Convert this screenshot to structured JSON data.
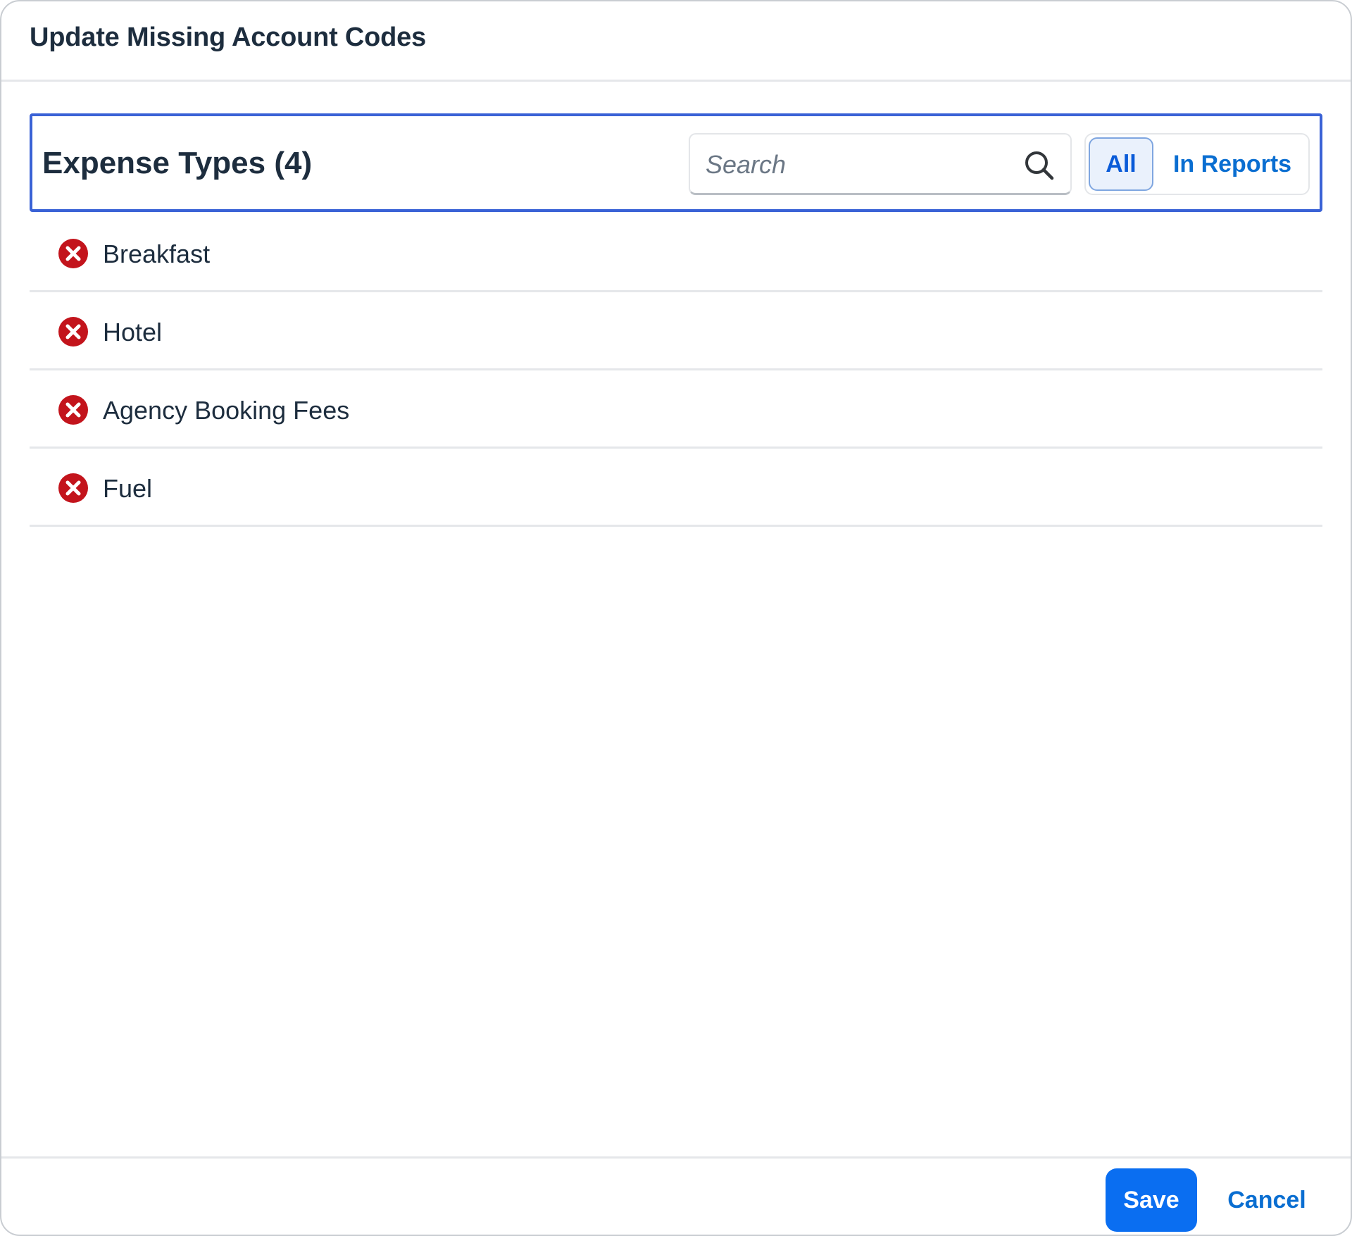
{
  "dialog": {
    "title": "Update Missing Account Codes"
  },
  "toolbar": {
    "title": "Expense Types (4)",
    "search": {
      "placeholder": "Search",
      "value": "",
      "icon": "search-icon"
    },
    "segments": [
      {
        "label": "All",
        "selected": true
      },
      {
        "label": "In Reports",
        "selected": false
      }
    ]
  },
  "items": [
    {
      "label": "Breakfast",
      "status_icon": "error-icon"
    },
    {
      "label": "Hotel",
      "status_icon": "error-icon"
    },
    {
      "label": "Agency Booking Fees",
      "status_icon": "error-icon"
    },
    {
      "label": "Fuel",
      "status_icon": "error-icon"
    }
  ],
  "footer": {
    "save_label": "Save",
    "cancel_label": "Cancel"
  },
  "colors": {
    "accent": "#0a6ef1",
    "error": "#c3141c",
    "focus_border": "#3a62d6",
    "text": "#1d2d3e"
  }
}
